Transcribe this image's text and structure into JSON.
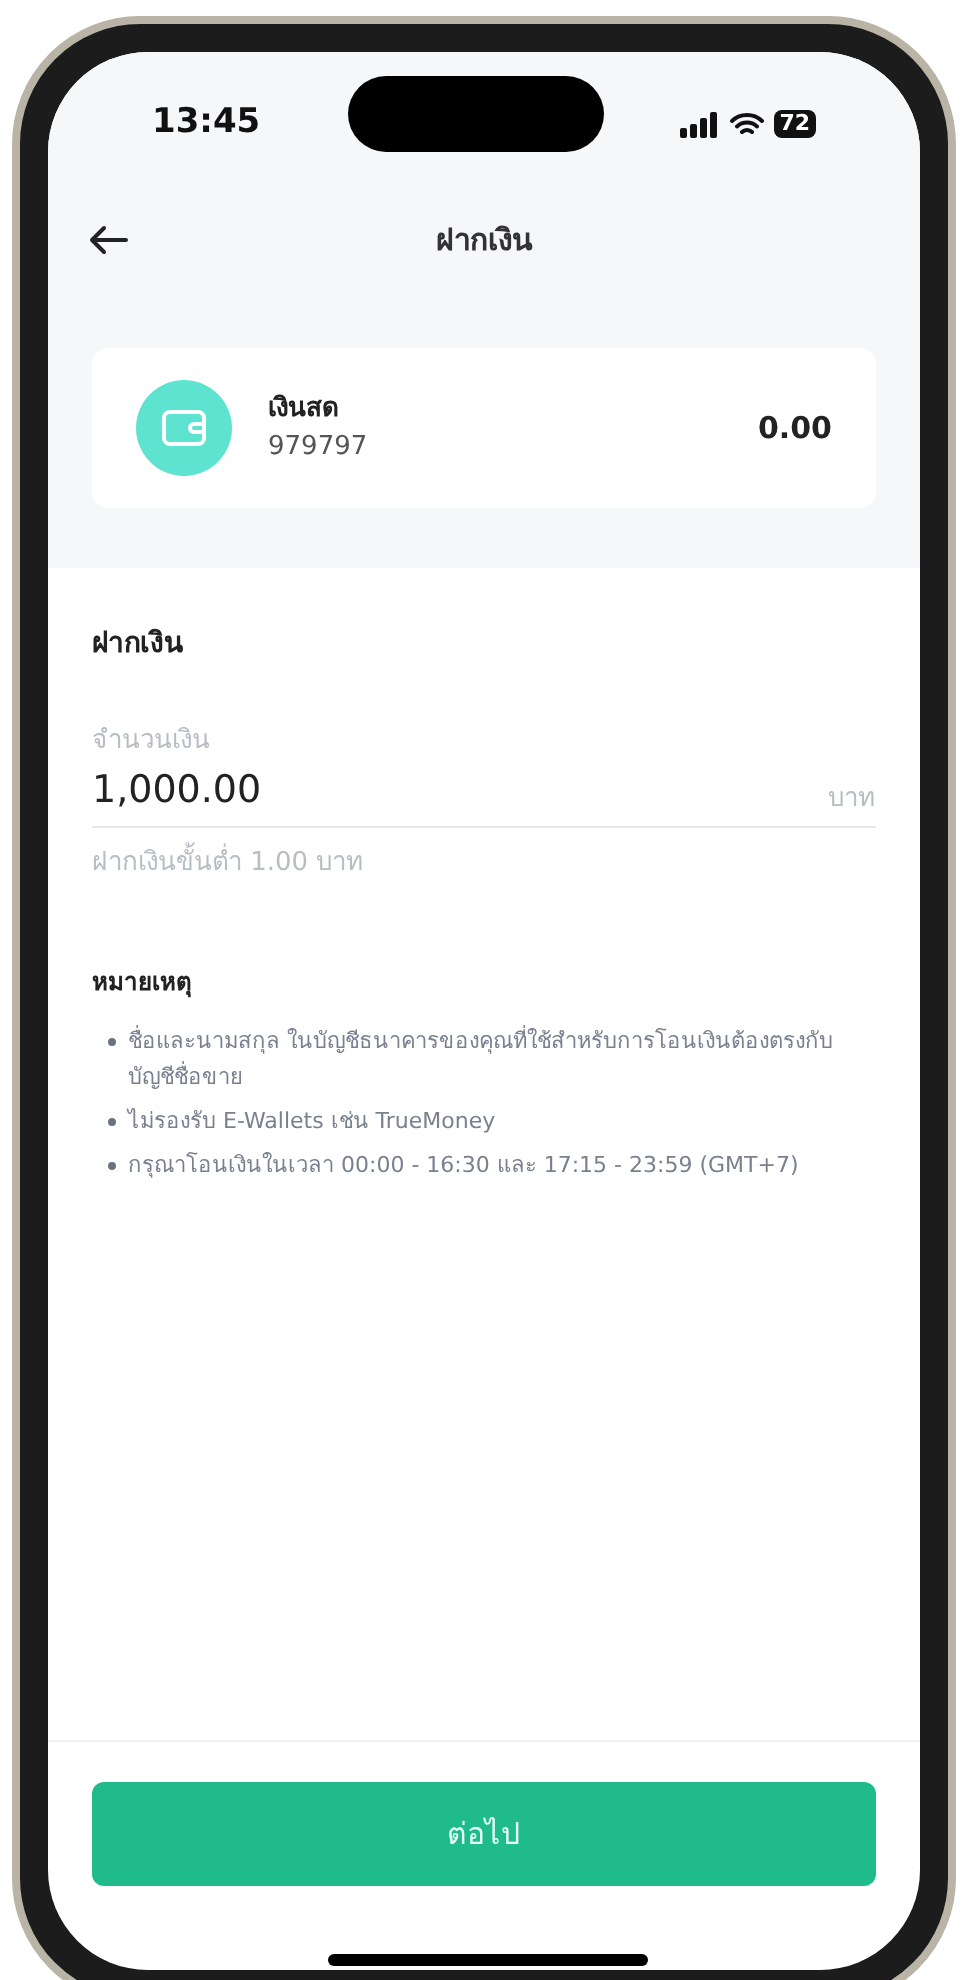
{
  "status_bar": {
    "time": "13:45",
    "battery": "72"
  },
  "header": {
    "title": "ฝากเงิน"
  },
  "wallet": {
    "name": "เงินสด",
    "account": "979797",
    "balance": "0.00"
  },
  "form": {
    "title": "ฝากเงิน",
    "amount_label": "จำนวนเงิน",
    "amount_value": "1,000.00",
    "unit": "บาท",
    "hint": "ฝากเงินขั้นต่ำ 1.00 บาท"
  },
  "notes": {
    "title": "หมายเหตุ",
    "items": [
      "ชื่อและนามสกุล ในบัญชีธนาคารของคุณที่ใช้สำหรับการโอนเงินต้องตรงกับบัญชีชื่อขาย",
      "ไม่รองรับ E-Wallets เช่น  TrueMoney",
      "กรุณาโอนเงินในเวลา 00:00 - 16:30 และ 17:15 - 23:59 (GMT+7)"
    ]
  },
  "button": {
    "label": "ต่อไป"
  }
}
